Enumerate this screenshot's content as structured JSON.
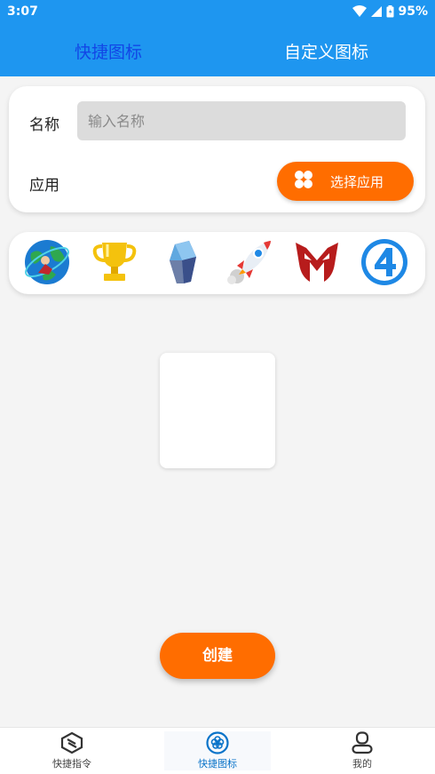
{
  "status_bar": {
    "time": "3:07",
    "battery": "95%"
  },
  "tabs": [
    {
      "label": "快捷图标",
      "active": true
    },
    {
      "label": "自定义图标",
      "active": false
    }
  ],
  "form": {
    "name_label": "名称",
    "name_placeholder": "输入名称",
    "name_value": "",
    "app_label": "应用",
    "select_app_label": "选择应用"
  },
  "icons": [
    {
      "icon": "globe-hero-icon"
    },
    {
      "icon": "trophy-icon"
    },
    {
      "icon": "crystal-icon"
    },
    {
      "icon": "rocket-icon"
    },
    {
      "icon": "mask-m-icon"
    },
    {
      "icon": "fantastic-four-icon"
    }
  ],
  "create_label": "创建",
  "bottom_nav": [
    {
      "label": "快捷指令",
      "icon": "shortcut-icon",
      "active": false
    },
    {
      "label": "快捷图标",
      "icon": "flower-icon",
      "active": true
    },
    {
      "label": "我的",
      "icon": "profile-icon",
      "active": false
    }
  ],
  "colors": {
    "header": "#1e96f0",
    "active_tab": "#1246e6",
    "accent": "#ff6d00",
    "nav_active": "#0a74c9"
  }
}
